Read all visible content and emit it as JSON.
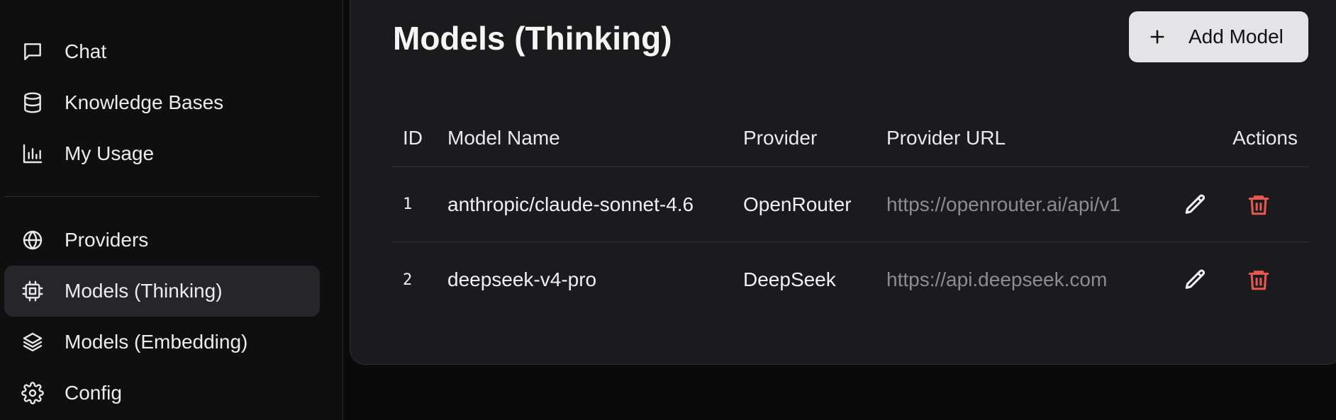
{
  "sidebar": {
    "items": [
      {
        "label": "Chat",
        "icon": "message-square-icon"
      },
      {
        "label": "Knowledge Bases",
        "icon": "database-icon"
      },
      {
        "label": "My Usage",
        "icon": "bar-chart-icon"
      },
      {
        "label": "Providers",
        "icon": "globe-icon"
      },
      {
        "label": "Models (Thinking)",
        "icon": "cpu-chip-icon",
        "active": true
      },
      {
        "label": "Models (Embedding)",
        "icon": "layers-icon"
      },
      {
        "label": "Config",
        "icon": "gear-icon"
      }
    ]
  },
  "page": {
    "title": "Models (Thinking)",
    "add_button_label": "Add Model"
  },
  "table": {
    "headers": {
      "id": "ID",
      "model_name": "Model Name",
      "provider": "Provider",
      "provider_url": "Provider URL",
      "actions": "Actions"
    },
    "rows": [
      {
        "id": "1",
        "model_name": "anthropic/claude-sonnet-4.6",
        "provider": "OpenRouter",
        "provider_url": "https://openrouter.ai/api/v1"
      },
      {
        "id": "2",
        "model_name": "deepseek-v4-pro",
        "provider": "DeepSeek",
        "provider_url": "https://api.deepseek.com"
      }
    ]
  },
  "colors": {
    "background": "#0a0a0b",
    "card": "#1b1b1d",
    "active_item": "#25252a",
    "button_bg": "#e4e4e7",
    "delete_red": "#e5584f",
    "url_gray": "#8c8c92"
  }
}
